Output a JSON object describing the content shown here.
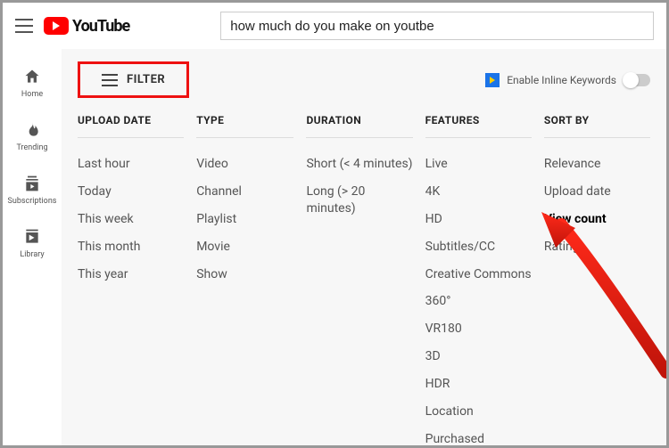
{
  "header": {
    "logo_text": "YouTube",
    "search_value": "how much do you make on youtbe"
  },
  "sidebar": {
    "items": [
      {
        "label": "Home"
      },
      {
        "label": "Trending"
      },
      {
        "label": "Subscriptions"
      },
      {
        "label": "Library"
      }
    ]
  },
  "filter": {
    "button_label": "FILTER",
    "inline_keywords_label": "Enable Inline Keywords"
  },
  "columns": {
    "upload_date": {
      "title": "UPLOAD DATE",
      "opts": [
        "Last hour",
        "Today",
        "This week",
        "This month",
        "This year"
      ]
    },
    "type": {
      "title": "TYPE",
      "opts": [
        "Video",
        "Channel",
        "Playlist",
        "Movie",
        "Show"
      ]
    },
    "duration": {
      "title": "DURATION",
      "opts": [
        "Short (< 4 minutes)",
        "Long (> 20 minutes)"
      ]
    },
    "features": {
      "title": "FEATURES",
      "opts": [
        "Live",
        "4K",
        "HD",
        "Subtitles/CC",
        "Creative Commons",
        "360°",
        "VR180",
        "3D",
        "HDR",
        "Location",
        "Purchased"
      ]
    },
    "sort_by": {
      "title": "SORT BY",
      "opts": [
        "Relevance",
        "Upload date",
        "View count",
        "Rating"
      ],
      "selected": "View count"
    }
  }
}
